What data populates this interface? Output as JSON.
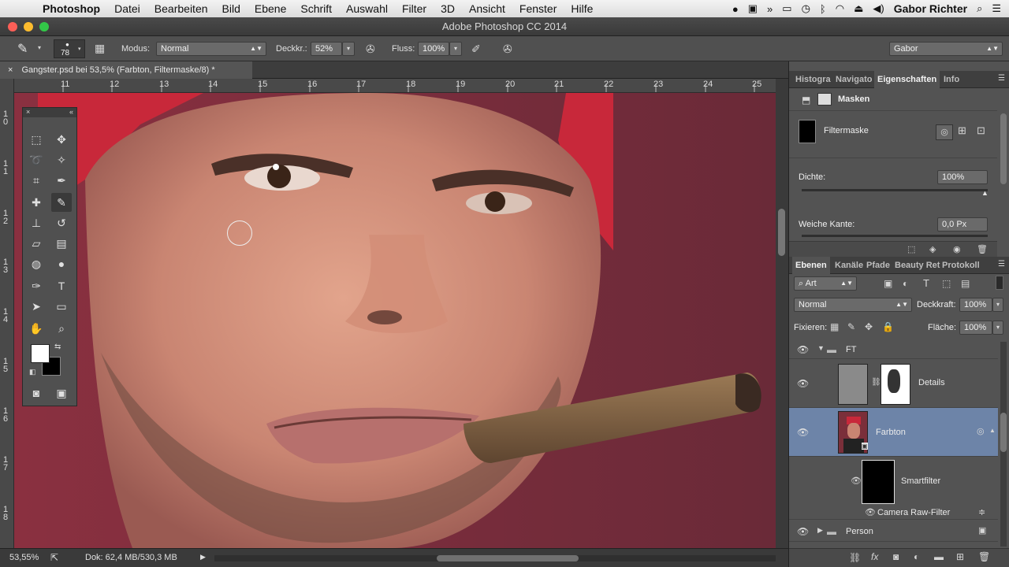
{
  "menubar": {
    "app": "Photoshop",
    "items": [
      "Datei",
      "Bearbeiten",
      "Bild",
      "Ebene",
      "Schrift",
      "Auswahl",
      "Filter",
      "3D",
      "Ansicht",
      "Fenster",
      "Hilfe"
    ],
    "user": "Gabor Richter"
  },
  "window": {
    "title": "Adobe Photoshop CC 2014"
  },
  "options": {
    "brush_size": "78",
    "modus_label": "Modus:",
    "modus_value": "Normal",
    "deckkr_label": "Deckkr.:",
    "deckkr_value": "52%",
    "fluss_label": "Fluss:",
    "fluss_value": "100%",
    "workspace": "Gabor"
  },
  "document": {
    "tab_title": "Gangster.psd bei 53,5% (Farbton, Filtermaske/8) *",
    "zoom": "53,55%",
    "doc_info": "Dok: 62,4 MB/530,3 MB"
  },
  "rulers": {
    "h": [
      "11",
      "12",
      "13",
      "14",
      "15",
      "16",
      "17",
      "18",
      "19",
      "20",
      "21",
      "22",
      "23",
      "24",
      "25"
    ],
    "v": [
      "1\n0",
      "1\n1",
      "1\n2",
      "1\n3",
      "1\n4",
      "1\n5",
      "1\n6",
      "1\n7",
      "1\n8"
    ]
  },
  "properties_panel": {
    "tabs": [
      "Histogra",
      "Navigato",
      "Eigenschaften",
      "Info"
    ],
    "active_tab": "Eigenschaften",
    "section_title": "Masken",
    "mask_name": "Filtermaske",
    "dichte_label": "Dichte:",
    "dichte_value": "100%",
    "weiche_kante_label": "Weiche Kante:",
    "weiche_kante_value": "0,0 Px"
  },
  "layers_panel": {
    "tabs": [
      "Ebenen",
      "Kanäle",
      "Pfade",
      "Beauty Ret",
      "Protokoll"
    ],
    "active_tab": "Ebenen",
    "filter_kind": "Art",
    "blend_mode": "Normal",
    "deckkraft_label": "Deckkraft:",
    "deckkraft_value": "100%",
    "fixieren_label": "Fixieren:",
    "flaeche_label": "Fläche:",
    "flaeche_value": "100%",
    "layers": [
      {
        "name": "FT",
        "type": "group"
      },
      {
        "name": "Details",
        "type": "adjustment"
      },
      {
        "name": "Farbton",
        "type": "smart-object",
        "selected": true
      },
      {
        "name": "Smartfilter",
        "type": "filter-mask"
      },
      {
        "name": "Camera Raw-Filter",
        "type": "filter"
      },
      {
        "name": "Person",
        "type": "group"
      }
    ]
  },
  "colors": {
    "selected_layer": "#6d84a8",
    "panel_bg": "#535353",
    "accent_red": "#c8283a"
  }
}
